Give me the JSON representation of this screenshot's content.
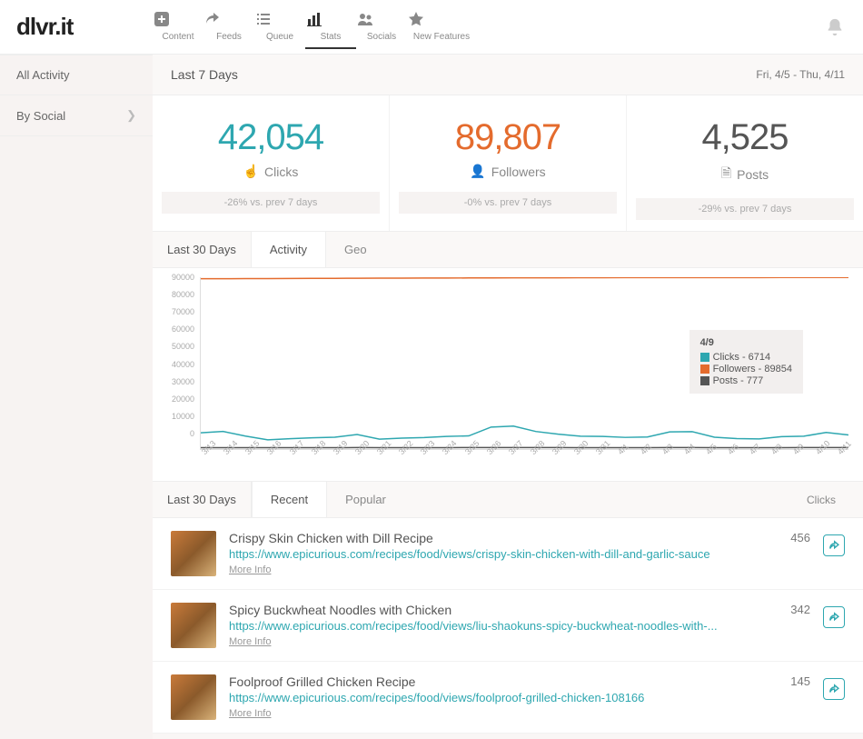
{
  "logo": "dlvr.it",
  "topnav": [
    {
      "label": "Content"
    },
    {
      "label": "Feeds"
    },
    {
      "label": "Queue"
    },
    {
      "label": "Stats"
    },
    {
      "label": "Socials"
    },
    {
      "label": "New Features"
    }
  ],
  "sidebar": {
    "items": [
      {
        "label": "All Activity"
      },
      {
        "label": "By Social"
      }
    ]
  },
  "header": {
    "range": "Last 7 Days",
    "dates": "Fri, 4/5 - Thu, 4/11"
  },
  "stats": {
    "clicks": {
      "value": "42,054",
      "label": "Clicks",
      "delta": "-26% vs. prev 7 days"
    },
    "followers": {
      "value": "89,807",
      "label": "Followers",
      "delta": "-0% vs. prev 7 days"
    },
    "posts": {
      "value": "4,525",
      "label": "Posts",
      "delta": "-29% vs. prev 7 days"
    }
  },
  "chart_tabs": {
    "range": "Last 30 Days",
    "activity": "Activity",
    "geo": "Geo"
  },
  "tooltip": {
    "date": "4/9",
    "clicks_label": "Clicks - 6714",
    "followers_label": "Followers - 89854",
    "posts_label": "Posts - 777"
  },
  "chart_data": {
    "type": "line",
    "ylim": [
      0,
      90000
    ],
    "yticks": [
      0,
      10000,
      20000,
      30000,
      40000,
      50000,
      60000,
      70000,
      80000,
      90000
    ],
    "categories": [
      "3/13",
      "3/14",
      "3/15",
      "3/16",
      "3/17",
      "3/18",
      "3/19",
      "3/20",
      "3/21",
      "3/22",
      "3/23",
      "3/24",
      "3/25",
      "3/26",
      "3/27",
      "3/28",
      "3/29",
      "3/30",
      "3/31",
      "4/1",
      "4/2",
      "4/3",
      "4/4",
      "4/5",
      "4/6",
      "4/7",
      "4/8",
      "4/9",
      "4/10",
      "4/11"
    ],
    "series": [
      {
        "name": "Clicks",
        "color": "#2ea7b0",
        "values": [
          8500,
          9200,
          6800,
          4800,
          5400,
          5900,
          6200,
          7600,
          5200,
          5700,
          6000,
          6600,
          6900,
          11500,
          12000,
          9200,
          7800,
          6700,
          6600,
          6100,
          6300,
          9000,
          9100,
          6200,
          5500,
          5300,
          6500,
          6714,
          8700,
          7400
        ]
      },
      {
        "name": "Followers",
        "color": "#e46b2d",
        "values": [
          89200,
          89230,
          89260,
          89300,
          89340,
          89380,
          89420,
          89460,
          89500,
          89530,
          89560,
          89590,
          89620,
          89650,
          89680,
          89710,
          89730,
          89750,
          89770,
          89790,
          89800,
          89810,
          89820,
          89830,
          89838,
          89844,
          89850,
          89854,
          89860,
          89870
        ]
      },
      {
        "name": "Posts",
        "color": "#555",
        "values": [
          720,
          740,
          710,
          690,
          700,
          720,
          730,
          750,
          700,
          710,
          720,
          740,
          760,
          780,
          790,
          770,
          750,
          740,
          730,
          720,
          730,
          760,
          770,
          730,
          710,
          700,
          740,
          777,
          780,
          760
        ]
      }
    ]
  },
  "list_tabs": {
    "range": "Last 30 Days",
    "recent": "Recent",
    "popular": "Popular",
    "metric": "Clicks"
  },
  "posts": [
    {
      "title": "Crispy Skin Chicken with Dill Recipe",
      "url": "https://www.epicurious.com/recipes/food/views/crispy-skin-chicken-with-dill-and-garlic-sauce",
      "more": "More Info",
      "count": "456"
    },
    {
      "title": "Spicy Buckwheat Noodles with Chicken",
      "url": "https://www.epicurious.com/recipes/food/views/liu-shaokuns-spicy-buckwheat-noodles-with-...",
      "more": "More Info",
      "count": "342"
    },
    {
      "title": "Foolproof Grilled Chicken Recipe",
      "url": "https://www.epicurious.com/recipes/food/views/foolproof-grilled-chicken-108166",
      "more": "More Info",
      "count": "145"
    }
  ]
}
